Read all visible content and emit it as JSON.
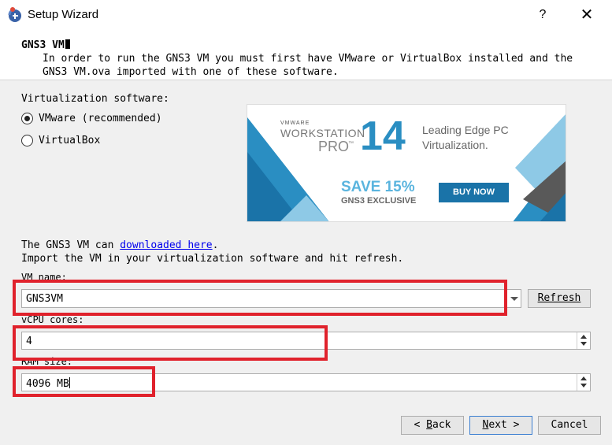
{
  "window": {
    "title": "Setup Wizard",
    "help_label": "?",
    "close_label": "✕"
  },
  "header": {
    "title": "GNS3 VM",
    "description": "In order to run the GNS3 VM you must first have VMware or VirtualBox installed and the GNS3 VM.ova imported with one of these software."
  },
  "virtualization": {
    "label": "Virtualization software:",
    "options": [
      {
        "label": "VMware (recommended)",
        "checked": true
      },
      {
        "label": "VirtualBox",
        "checked": false
      }
    ]
  },
  "ad": {
    "brand": "VMWARE",
    "product": "WORKSTATION",
    "edition": "PRO",
    "tm": "™",
    "version": "14",
    "tagline_1": "Leading Edge PC",
    "tagline_2": "Virtualization.",
    "promo": "SAVE 15%",
    "promo_sub": "GNS3 EXCLUSIVE",
    "cta": "BUY NOW",
    "colors": {
      "blue": "#2a8ec2",
      "dark_blue": "#1a73a8",
      "light_blue": "#8ec9e6",
      "gray": "#595959"
    }
  },
  "info": {
    "line1_prefix": "The GNS3 VM can ",
    "link": "downloaded here",
    "line1_suffix": ".",
    "line2": "Import the VM in your virtualization software and hit refresh."
  },
  "vm_name": {
    "label": "VM name:",
    "value": "GNS3VM",
    "refresh_label": "Refresh"
  },
  "vcpu": {
    "label": "vCPU cores:",
    "value": "4"
  },
  "ram": {
    "label": "RAM size:",
    "value": "4096 MB"
  },
  "footer": {
    "back_prefix": "< ",
    "back_key": "B",
    "back_rest": "ack",
    "next_key": "N",
    "next_rest": "ext >",
    "cancel_label": "Cancel"
  },
  "highlight_color": "#e0222c"
}
